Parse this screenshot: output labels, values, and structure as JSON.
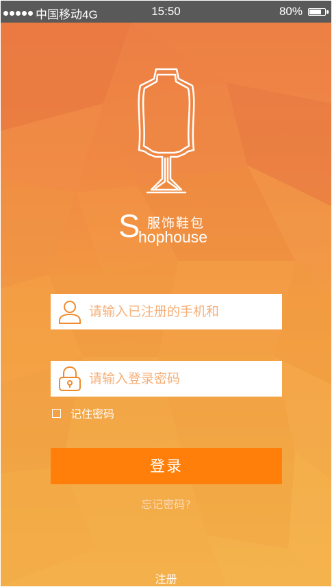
{
  "status_bar": {
    "carrier": "中国移动4G",
    "time": "15:50",
    "battery_text": "80%",
    "battery_level": 0.8,
    "signal_icon": "signal-dots-icon",
    "battery_icon": "battery-icon"
  },
  "brand": {
    "logo_icon": "mannequin-icon",
    "initial": "S",
    "chinese_name": "服饰鞋包",
    "english_rest": "hophouse"
  },
  "login_form": {
    "username_placeholder": "请输入已注册的手机和",
    "username_icon": "user-icon",
    "password_placeholder": "请输入登录密码",
    "password_icon": "lock-icon",
    "remember_label": "记住密码",
    "remember_checked": false,
    "submit_label": "登录",
    "forgot_label": "忘记密码?",
    "register_label": "注册"
  },
  "colors": {
    "accent": "#ff7f0a",
    "background_top": "#ec7c45",
    "background_bottom": "#f3b04a",
    "status_bar": "#595959",
    "placeholder": "#f5b07a"
  }
}
